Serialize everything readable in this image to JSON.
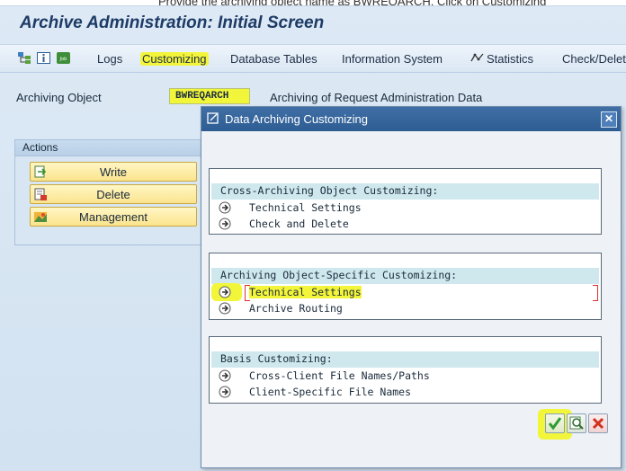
{
  "top_note": "Provide the archiving object name as BWREQARCH, Click on Customizing",
  "window": {
    "title": "Archive Administration: Initial Screen"
  },
  "toolbar": {
    "logs": "Logs",
    "customizing": "Customizing",
    "database_tables": "Database Tables",
    "information_system": "Information System",
    "statistics": "Statistics",
    "check_delete": "Check/Delete"
  },
  "archiving_object": {
    "label": "Archiving Object",
    "value": "BWREQARCH",
    "description": "Archiving of Request Administration Data"
  },
  "actions": {
    "header": "Actions",
    "write": "Write",
    "delete": "Delete",
    "management": "Management"
  },
  "dialog": {
    "title": "Data Archiving Customizing",
    "groups": [
      {
        "header": "Cross-Archiving Object Customizing:",
        "items": [
          "Technical Settings",
          "Check and Delete"
        ]
      },
      {
        "header": "Archiving Object-Specific Customizing:",
        "items": [
          "Technical Settings",
          "Archive Routing"
        ]
      },
      {
        "header": "Basis Customizing:",
        "items": [
          "Cross-Client File Names/Paths",
          "Client-Specific File Names"
        ]
      }
    ]
  },
  "colors": {
    "highlight": "#f3f53a",
    "title_bar": "#2e5d93",
    "window_bg": "#d2e2f1"
  },
  "icons": [
    "execute-icon",
    "find-icon",
    "cancel-icon",
    "close-icon",
    "write-icon",
    "delete-icon",
    "management-icon",
    "statistics-icon"
  ]
}
